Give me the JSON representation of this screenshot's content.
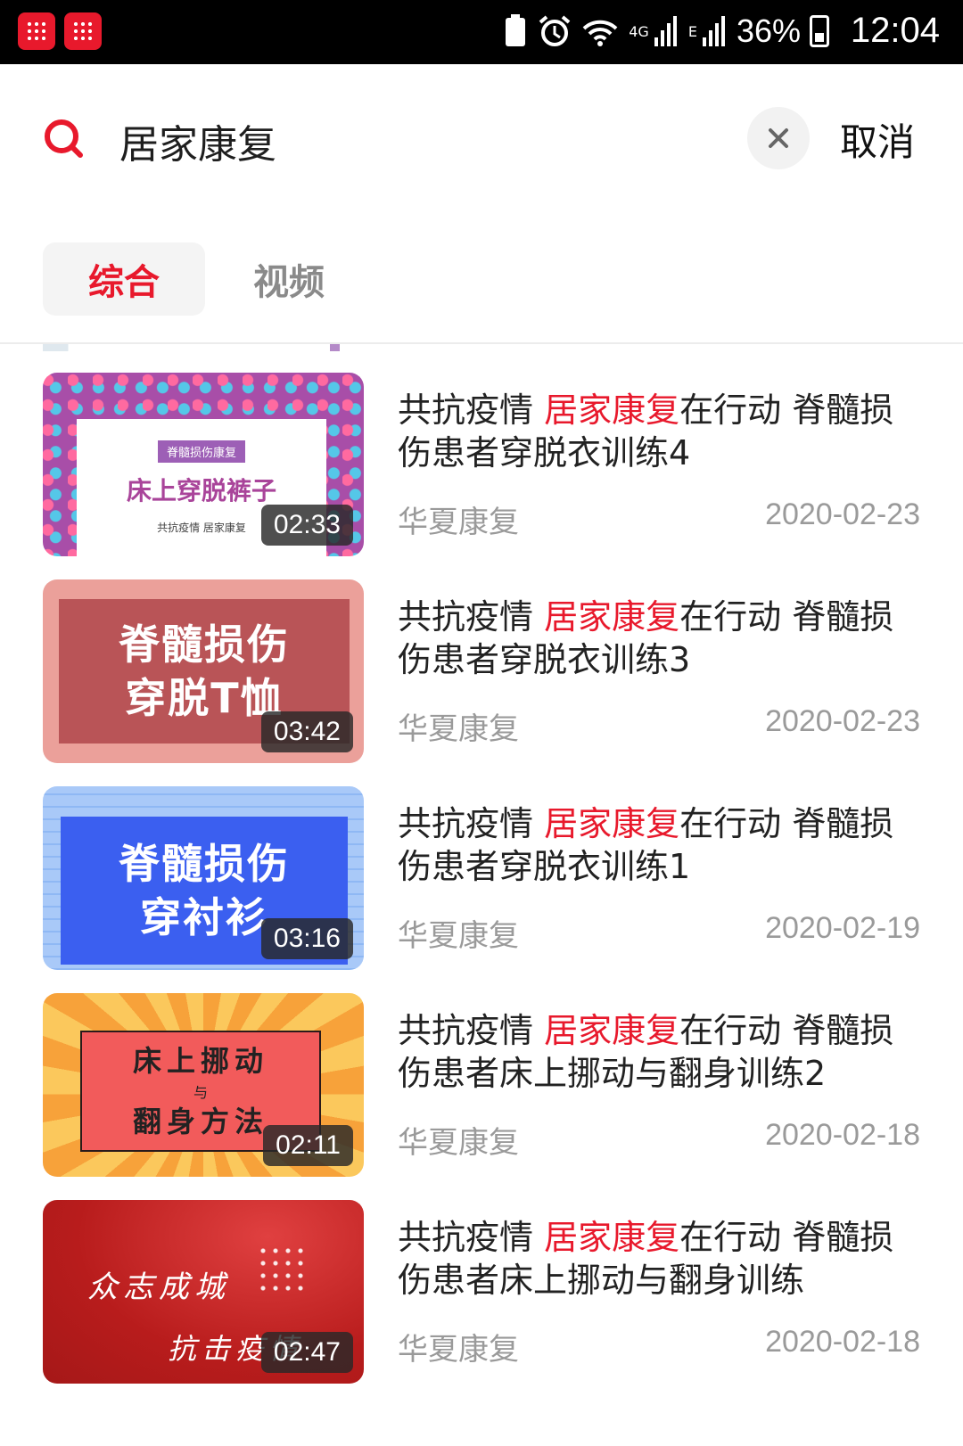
{
  "status_bar": {
    "battery_percent": "36%",
    "time": "12:04",
    "network_4g": "4G",
    "network_e": "E"
  },
  "search": {
    "query": "居家康复",
    "cancel_label": "取消"
  },
  "tabs": [
    {
      "label": "综合",
      "active": true
    },
    {
      "label": "视频",
      "active": false
    }
  ],
  "results": [
    {
      "title_prefix": "共抗疫情 ",
      "title_highlight": "居家康复",
      "title_suffix": "在行动 脊髓损伤患者穿脱衣训练4",
      "author": "华夏康复",
      "date": "2020-02-23",
      "duration": "02:33",
      "thumb": {
        "tag": "脊髓损伤康复",
        "main": "床上穿脱裤子",
        "sub": "共抗疫情  居家康复"
      }
    },
    {
      "title_prefix": "共抗疫情 ",
      "title_highlight": "居家康复",
      "title_suffix": "在行动 脊髓损伤患者穿脱衣训练3",
      "author": "华夏康复",
      "date": "2020-02-23",
      "duration": "03:42",
      "thumb": {
        "line1": "脊髓损伤",
        "line2": "穿脱T恤"
      }
    },
    {
      "title_prefix": "共抗疫情 ",
      "title_highlight": "居家康复",
      "title_suffix": "在行动 脊髓损伤患者穿脱衣训练1",
      "author": "华夏康复",
      "date": "2020-02-19",
      "duration": "03:16",
      "thumb": {
        "line1": "脊髓损伤",
        "line2": "穿衬衫"
      }
    },
    {
      "title_prefix": "共抗疫情 ",
      "title_highlight": "居家康复",
      "title_suffix": "在行动 脊髓损伤患者床上挪动与翻身训练2",
      "author": "华夏康复",
      "date": "2020-02-18",
      "duration": "02:11",
      "thumb": {
        "line1": "床上挪动",
        "small": "与",
        "line2": "翻身方法"
      }
    },
    {
      "title_prefix": "共抗疫情 ",
      "title_highlight": "居家康复",
      "title_suffix": "在行动 脊髓损伤患者床上挪动与翻身训练",
      "author": "华夏康复",
      "date": "2020-02-18",
      "duration": "02:47",
      "thumb": {
        "line1": "众志成城",
        "line2": "抗击疫情"
      }
    }
  ],
  "colors": {
    "accent": "#e8192c",
    "muted": "#9a9a9a"
  }
}
